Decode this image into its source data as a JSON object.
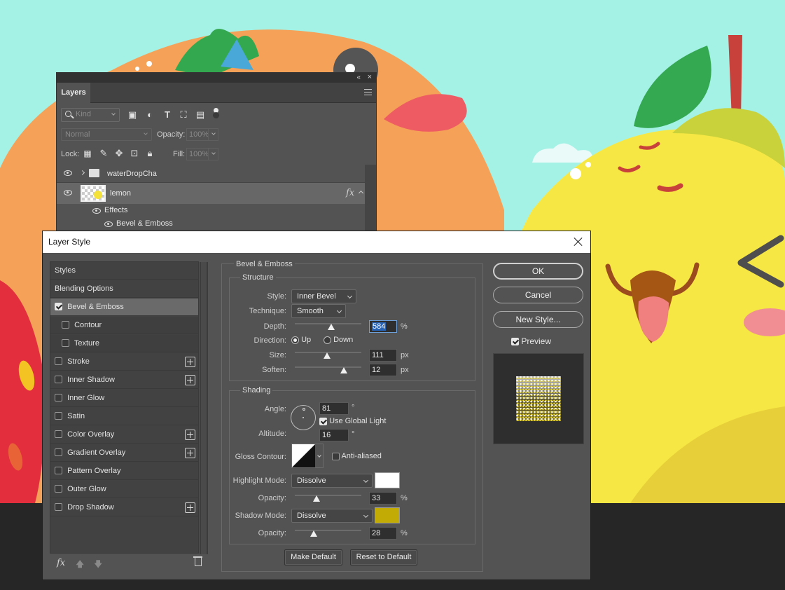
{
  "layers_panel": {
    "tab_label": "Layers",
    "filter": {
      "label": "Kind"
    },
    "blend": {
      "mode": "Normal",
      "opacity_label": "Opacity:",
      "opacity_value": "100%"
    },
    "lock": {
      "label": "Lock:",
      "fill_label": "Fill:",
      "fill_value": "100%"
    },
    "layers": [
      {
        "name": "waterDropCha",
        "type": "group"
      },
      {
        "name": "lemon",
        "type": "layer",
        "fx": "fx"
      }
    ],
    "effects_label": "Effects",
    "effect_item": "Bevel & Emboss"
  },
  "dialog": {
    "title": "Layer Style",
    "styles": [
      {
        "label": "Styles",
        "kind": "header"
      },
      {
        "label": "Blending Options",
        "kind": "header"
      },
      {
        "label": "Bevel & Emboss",
        "checked": true,
        "selected": true
      },
      {
        "label": "Contour",
        "checked": false,
        "sub": true
      },
      {
        "label": "Texture",
        "checked": false,
        "sub": true
      },
      {
        "label": "Stroke",
        "checked": false,
        "plus": true
      },
      {
        "label": "Inner Shadow",
        "checked": false,
        "plus": true
      },
      {
        "label": "Inner Glow",
        "checked": false
      },
      {
        "label": "Satin",
        "checked": false
      },
      {
        "label": "Color Overlay",
        "checked": false,
        "plus": true
      },
      {
        "label": "Gradient Overlay",
        "checked": false,
        "plus": true
      },
      {
        "label": "Pattern Overlay",
        "checked": false
      },
      {
        "label": "Outer Glow",
        "checked": false
      },
      {
        "label": "Drop Shadow",
        "checked": false,
        "plus": true
      }
    ],
    "bevel": {
      "section_title": "Bevel & Emboss",
      "structure": {
        "title": "Structure",
        "style_label": "Style:",
        "style_value": "Inner Bevel",
        "technique_label": "Technique:",
        "technique_value": "Smooth",
        "depth_label": "Depth:",
        "depth_value": "584",
        "depth_unit": "%",
        "depth_slider": 0.55,
        "direction_label": "Direction:",
        "direction_up": "Up",
        "direction_down": "Down",
        "direction_selected": "Up",
        "size_label": "Size:",
        "size_value": "111",
        "size_unit": "px",
        "size_slider": 0.48,
        "soften_label": "Soften:",
        "soften_value": "12",
        "soften_unit": "px",
        "soften_slider": 0.74
      },
      "shading": {
        "title": "Shading",
        "angle_label": "Angle:",
        "angle_value": "81",
        "angle_unit": "°",
        "global_light_label": "Use Global Light",
        "global_light_checked": true,
        "altitude_label": "Altitude:",
        "altitude_value": "16",
        "altitude_unit": "°",
        "gloss_label": "Gloss Contour:",
        "anti_aliased_label": "Anti-aliased",
        "anti_aliased_checked": false,
        "highlight_mode_label": "Highlight Mode:",
        "highlight_mode_value": "Dissolve",
        "highlight_color": "#ffffff",
        "highlight_opacity_label": "Opacity:",
        "highlight_opacity_value": "33",
        "highlight_opacity_unit": "%",
        "highlight_opacity_slider": 0.33,
        "shadow_mode_label": "Shadow Mode:",
        "shadow_mode_value": "Dissolve",
        "shadow_color": "#c2ab05",
        "shadow_opacity_label": "Opacity:",
        "shadow_opacity_value": "28",
        "shadow_opacity_unit": "%",
        "shadow_opacity_slider": 0.28
      },
      "make_default": "Make Default",
      "reset_default": "Reset to Default"
    },
    "buttons": {
      "ok": "OK",
      "cancel": "Cancel",
      "new_style": "New Style...",
      "preview_label": "Preview",
      "preview_checked": true
    },
    "footer_fx": "fx"
  }
}
